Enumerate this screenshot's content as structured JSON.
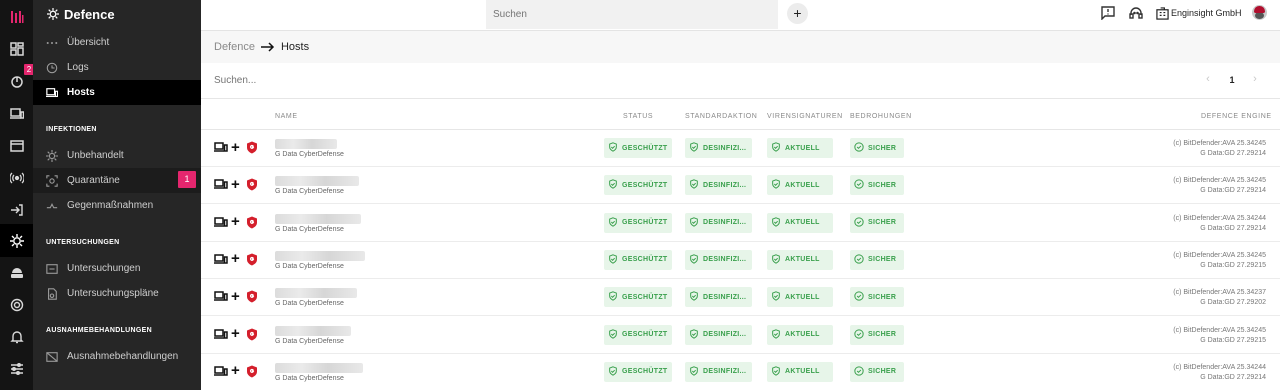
{
  "app": {
    "title": "Defence",
    "rail_badge": "2"
  },
  "sidebar": {
    "items": [
      {
        "label": "Übersicht",
        "icon": "dots-icon"
      },
      {
        "label": "Logs",
        "icon": "clock-icon"
      },
      {
        "label": "Hosts",
        "icon": "devices-icon"
      }
    ],
    "sections": [
      {
        "title": "INFEKTIONEN",
        "items": [
          {
            "label": "Unbehandelt",
            "icon": "virus-icon"
          },
          {
            "label": "Quarantäne",
            "icon": "quarantine-icon",
            "count": "1"
          },
          {
            "label": "Gegenmaßnahmen",
            "icon": "countermeasure-icon"
          }
        ]
      },
      {
        "title": "UNTERSUCHUNGEN",
        "items": [
          {
            "label": "Untersuchungen",
            "icon": "scan-icon"
          },
          {
            "label": "Untersuchungspläne",
            "icon": "schedule-icon"
          }
        ]
      },
      {
        "title": "AUSNAHMEBEHANDLUNGEN",
        "items": [
          {
            "label": "Ausnahmebehandlungen",
            "icon": "exception-icon"
          }
        ]
      }
    ]
  },
  "topbar": {
    "search_placeholder": "Suchen",
    "add_label": "+",
    "company": "Enginsight GmbH"
  },
  "breadcrumb": {
    "parent": "Defence",
    "current": "Hosts"
  },
  "list": {
    "search_placeholder": "Suchen...",
    "page": "1",
    "prev": "‹",
    "next": "›"
  },
  "table": {
    "columns": {
      "name": "NAME",
      "status": "STATUS",
      "action": "STANDARDAKTION",
      "signatures": "VIRENSIGNATUREN",
      "threats": "BEDROHUNGEN",
      "engine": "DEFENCE ENGINE"
    },
    "rows": [
      {
        "sub": "G Data CyberDefense",
        "status": "GESCHÜTZT",
        "action": "DESINFIZI...",
        "signatures": "AKTUELL",
        "threats": "SICHER",
        "engine1": "(c) BitDefender:AVA 25.34245",
        "engine2": "G Data:GD 27.29214"
      },
      {
        "sub": "G Data CyberDefense",
        "status": "GESCHÜTZT",
        "action": "DESINFIZI...",
        "signatures": "AKTUELL",
        "threats": "SICHER",
        "engine1": "(c) BitDefender:AVA 25.34245",
        "engine2": "G Data:GD 27.29214"
      },
      {
        "sub": "G Data CyberDefense",
        "status": "GESCHÜTZT",
        "action": "DESINFIZI...",
        "signatures": "AKTUELL",
        "threats": "SICHER",
        "engine1": "(c) BitDefender:AVA 25.34244",
        "engine2": "G Data:GD 27.29214"
      },
      {
        "sub": "G Data CyberDefense",
        "status": "GESCHÜTZT",
        "action": "DESINFIZI...",
        "signatures": "AKTUELL",
        "threats": "SICHER",
        "engine1": "(c) BitDefender:AVA 25.34245",
        "engine2": "G Data:GD 27.29215"
      },
      {
        "sub": "G Data CyberDefense",
        "status": "GESCHÜTZT",
        "action": "DESINFIZI...",
        "signatures": "AKTUELL",
        "threats": "SICHER",
        "engine1": "(c) BitDefender:AVA 25.34237",
        "engine2": "G Data:GD 27.29202"
      },
      {
        "sub": "G Data CyberDefense",
        "status": "GESCHÜTZT",
        "action": "DESINFIZI...",
        "signatures": "AKTUELL",
        "threats": "SICHER",
        "engine1": "(c) BitDefender:AVA 25.34245",
        "engine2": "G Data:GD 27.29215"
      },
      {
        "sub": "G Data CyberDefense",
        "status": "GESCHÜTZT",
        "action": "DESINFIZI...",
        "signatures": "AKTUELL",
        "threats": "SICHER",
        "engine1": "(c) BitDefender:AVA 25.34244",
        "engine2": "G Data:GD 27.29214"
      }
    ]
  },
  "colors": {
    "accent": "#e4266e",
    "ok_bg": "#e7f5e9",
    "ok_fg": "#3aa04d",
    "sidebar_bg": "#262626",
    "rail_bg": "#141414"
  }
}
